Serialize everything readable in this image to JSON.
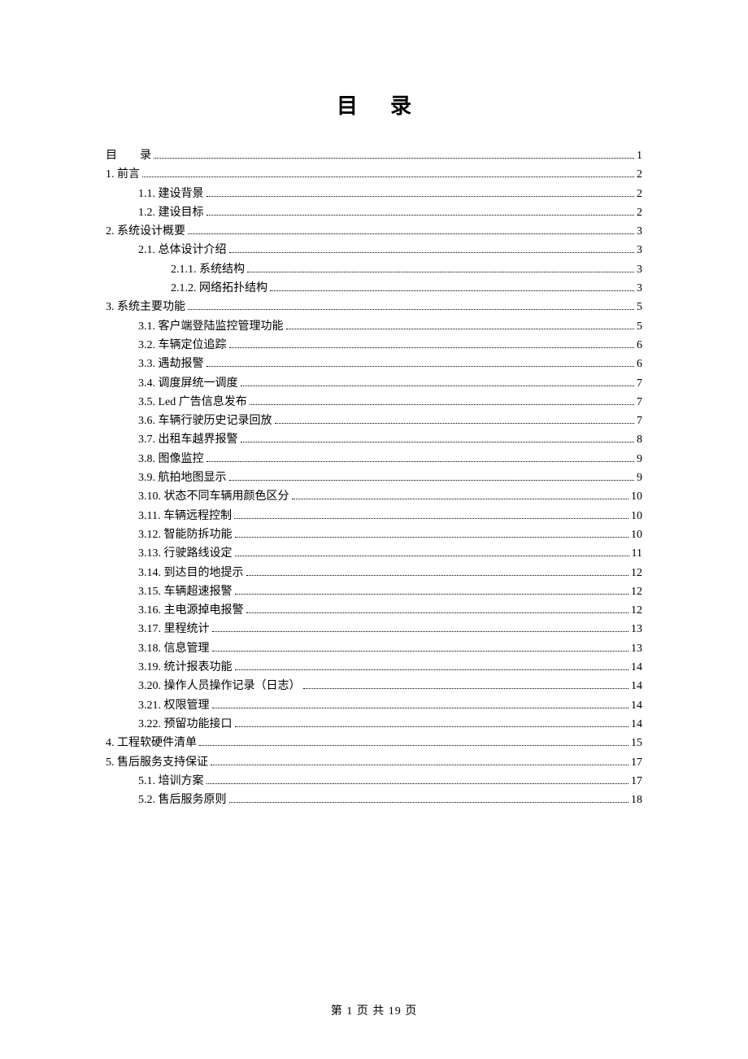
{
  "title": "目录",
  "footer": "第 1 页 共 19 页",
  "toc": [
    {
      "indent": 0,
      "label": "目　　录",
      "page": "1"
    },
    {
      "indent": 0,
      "label": "1. 前言",
      "page": "2"
    },
    {
      "indent": 1,
      "label": "1.1. 建设背景",
      "page": "2"
    },
    {
      "indent": 1,
      "label": "1.2. 建设目标",
      "page": "2"
    },
    {
      "indent": 0,
      "label": "2. 系统设计概要",
      "page": "3"
    },
    {
      "indent": 1,
      "label": "2.1. 总体设计介绍",
      "page": "3"
    },
    {
      "indent": 2,
      "label": "2.1.1. 系统结构",
      "page": "3"
    },
    {
      "indent": 2,
      "label": "2.1.2. 网络拓扑结构",
      "page": "3"
    },
    {
      "indent": 0,
      "label": "3. 系统主要功能",
      "page": "5"
    },
    {
      "indent": 1,
      "label": "3.1. 客户端登陆监控管理功能",
      "page": "5"
    },
    {
      "indent": 1,
      "label": "3.2. 车辆定位追踪",
      "page": "6"
    },
    {
      "indent": 1,
      "label": "3.3. 遇劫报警",
      "page": "6"
    },
    {
      "indent": 1,
      "label": "3.4. 调度屏统一调度",
      "page": "7"
    },
    {
      "indent": 1,
      "label": "3.5. Led 广告信息发布",
      "page": "7"
    },
    {
      "indent": 1,
      "label": "3.6. 车辆行驶历史记录回放",
      "page": "7"
    },
    {
      "indent": 1,
      "label": "3.7. 出租车越界报警",
      "page": "8"
    },
    {
      "indent": 1,
      "label": "3.8. 图像监控",
      "page": "9"
    },
    {
      "indent": 1,
      "label": "3.9. 航拍地图显示",
      "page": "9"
    },
    {
      "indent": 1,
      "label": "3.10. 状态不同车辆用颜色区分",
      "page": "10"
    },
    {
      "indent": 1,
      "label": "3.11. 车辆远程控制",
      "page": "10"
    },
    {
      "indent": 1,
      "label": "3.12. 智能防拆功能",
      "page": "10"
    },
    {
      "indent": 1,
      "label": "3.13. 行驶路线设定",
      "page": "11"
    },
    {
      "indent": 1,
      "label": "3.14. 到达目的地提示",
      "page": "12"
    },
    {
      "indent": 1,
      "label": "3.15. 车辆超速报警",
      "page": "12"
    },
    {
      "indent": 1,
      "label": "3.16. 主电源掉电报警",
      "page": "12"
    },
    {
      "indent": 1,
      "label": "3.17. 里程统计",
      "page": "13"
    },
    {
      "indent": 1,
      "label": "3.18. 信息管理",
      "page": "13"
    },
    {
      "indent": 1,
      "label": "3.19. 统计报表功能",
      "page": "14"
    },
    {
      "indent": 1,
      "label": "3.20. 操作人员操作记录（日志）",
      "page": "14"
    },
    {
      "indent": 1,
      "label": "3.21. 权限管理",
      "page": "14"
    },
    {
      "indent": 1,
      "label": "3.22. 预留功能接口",
      "page": "14"
    },
    {
      "indent": 0,
      "label": "4. 工程软硬件清单",
      "page": "15"
    },
    {
      "indent": 0,
      "label": "5. 售后服务支持保证",
      "page": "17"
    },
    {
      "indent": 1,
      "label": "5.1. 培训方案",
      "page": "17"
    },
    {
      "indent": 1,
      "label": "5.2. 售后服务原则",
      "page": "18"
    }
  ]
}
